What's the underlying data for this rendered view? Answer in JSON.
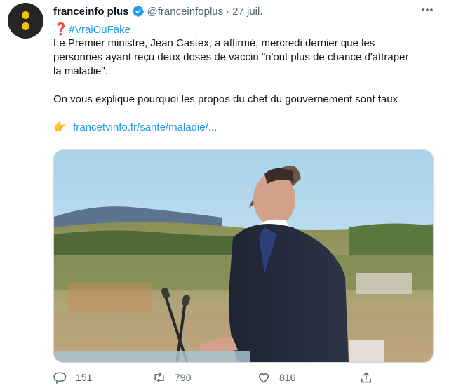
{
  "author": {
    "display_name": "franceinfo plus",
    "handle": "@franceinfoplus",
    "separator": "·",
    "date": "27 juil."
  },
  "body": {
    "hashtag": "#VraiOuFake",
    "paragraph1_line1": "Le Premier ministre, Jean Castex, a affirmé, mercredi dernier que les",
    "paragraph1_line2": "personnes ayant reçu deux doses de vaccin \"n'ont plus de chance d'attraper",
    "paragraph1_line3": "la maladie\".",
    "paragraph2": "On vous explique pourquoi les propos du chef du gouvernement sont faux",
    "link": "francetvinfo.fr/sante/maladie/..."
  },
  "icons": {
    "question_emoji": "❓",
    "pointing_emoji": "👉"
  },
  "actions": {
    "replies": "151",
    "retweets": "790",
    "likes": "816"
  },
  "colors": {
    "accent": "#1d9bf0",
    "avatar_bg": "#262626",
    "avatar_dots": "#f5c400",
    "muted": "#536471"
  }
}
